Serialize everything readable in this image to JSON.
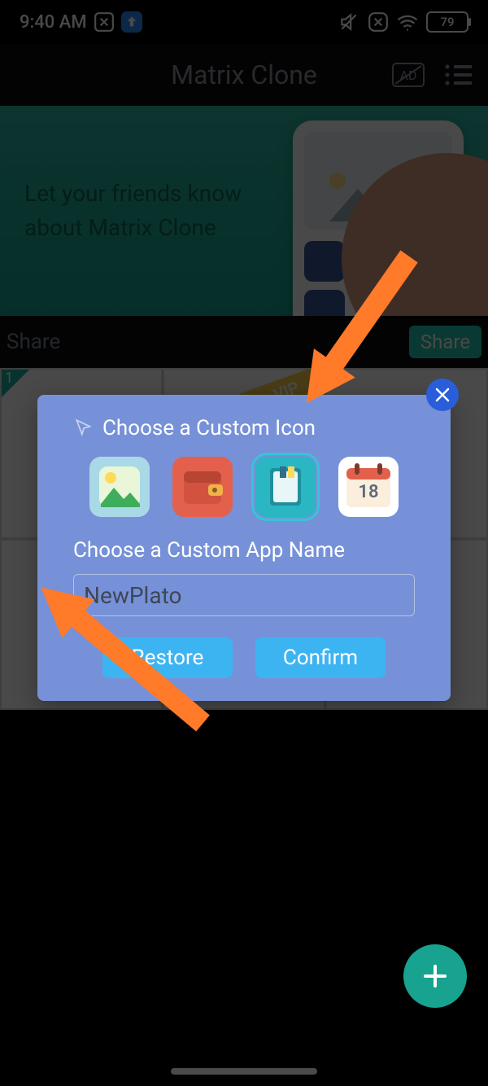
{
  "status": {
    "time": "9:40 AM",
    "battery": "79"
  },
  "header": {
    "title": "Matrix Clone"
  },
  "shareBanner": {
    "line1": "Let your friends know",
    "line2": "about Matrix Clone"
  },
  "shareStrip": {
    "label": "Share",
    "button": "Share"
  },
  "gridCell": {
    "num": "1",
    "vip": "VIP"
  },
  "dialog": {
    "title": "Choose a Custom Icon",
    "subtitle": "Choose a Custom App Name",
    "input_value": "NewPlato",
    "buttons": {
      "restore": "Restore",
      "confirm": "Confirm"
    },
    "icons": [
      "gallery-icon",
      "wallet-icon",
      "contacts-icon",
      "calendar-icon"
    ],
    "calendar_day": "18"
  }
}
